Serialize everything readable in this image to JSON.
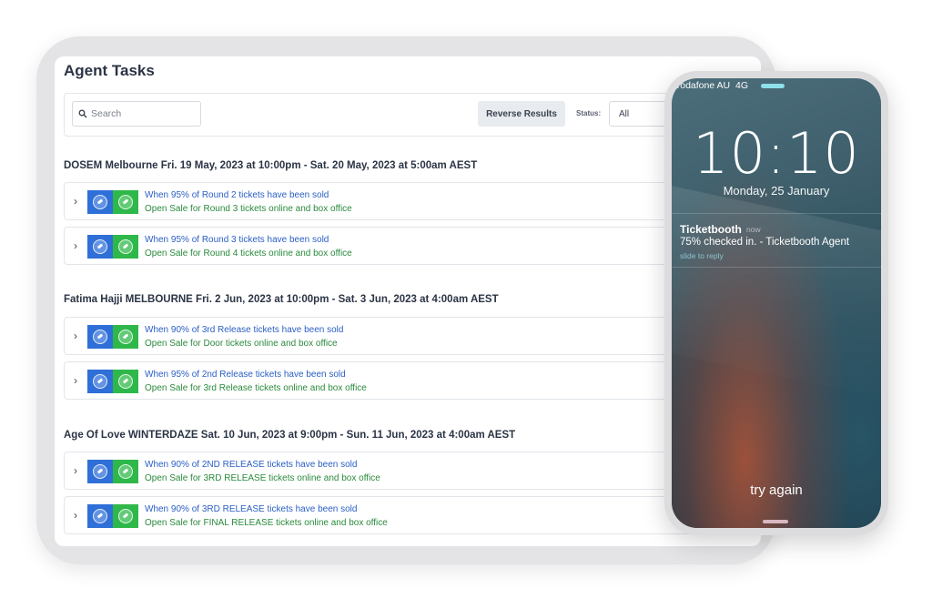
{
  "app": {
    "title": "Agent Tasks"
  },
  "toolbar": {
    "search_placeholder": "Search",
    "reverse_label": "Reverse Results",
    "status_label": "Status:",
    "status_value": "All"
  },
  "events": [
    {
      "title": "DOSEM Melbourne Fri. 19 May, 2023 at 10:00pm - Sat. 20 May, 2023 at 5:00am AEST",
      "tasks": [
        {
          "trigger": "When 95% of Round 2 tickets have been sold",
          "action": "Open Sale for Round 3 tickets online and box office"
        },
        {
          "trigger": "When 95% of Round 3 tickets have been sold",
          "action": "Open Sale for Round 4 tickets online and box office"
        }
      ]
    },
    {
      "title": "Fatima Hajji MELBOURNE Fri. 2 Jun, 2023 at 10:00pm - Sat. 3 Jun, 2023 at 4:00am AEST",
      "tasks": [
        {
          "trigger": "When 90% of 3rd Release tickets have been sold",
          "action": "Open Sale for Door tickets online and box office"
        },
        {
          "trigger": "When 95% of 2nd Release tickets have been sold",
          "action": "Open Sale for 3rd Release tickets online and box office"
        }
      ]
    },
    {
      "title": "Age Of Love WINTERDAZE Sat. 10 Jun, 2023 at 9:00pm - Sun. 11 Jun, 2023 at 4:00am AEST",
      "tasks": [
        {
          "trigger": "When 90% of 2ND RELEASE tickets have been sold",
          "action": "Open Sale for 3RD RELEASE tickets online and box office"
        },
        {
          "trigger": "When 90% of 3RD RELEASE tickets have been sold",
          "action": "Open Sale for FINAL RELEASE tickets online and box office"
        }
      ]
    }
  ],
  "colors": {
    "trigger": "#2a5fc4",
    "action": "#2a8a3c",
    "badge_blue": "#2f6fd8",
    "badge_green": "#2fb84a"
  },
  "phone": {
    "carrier": "vodafone AU",
    "network": "4G",
    "time": "10:10",
    "date": "Monday, 25 January",
    "notification": {
      "app": "Ticketbooth",
      "time": "now",
      "body": "75% checked in. - Ticketbooth Agent",
      "hint": "slide to reply"
    },
    "bottom_text": "try again"
  }
}
